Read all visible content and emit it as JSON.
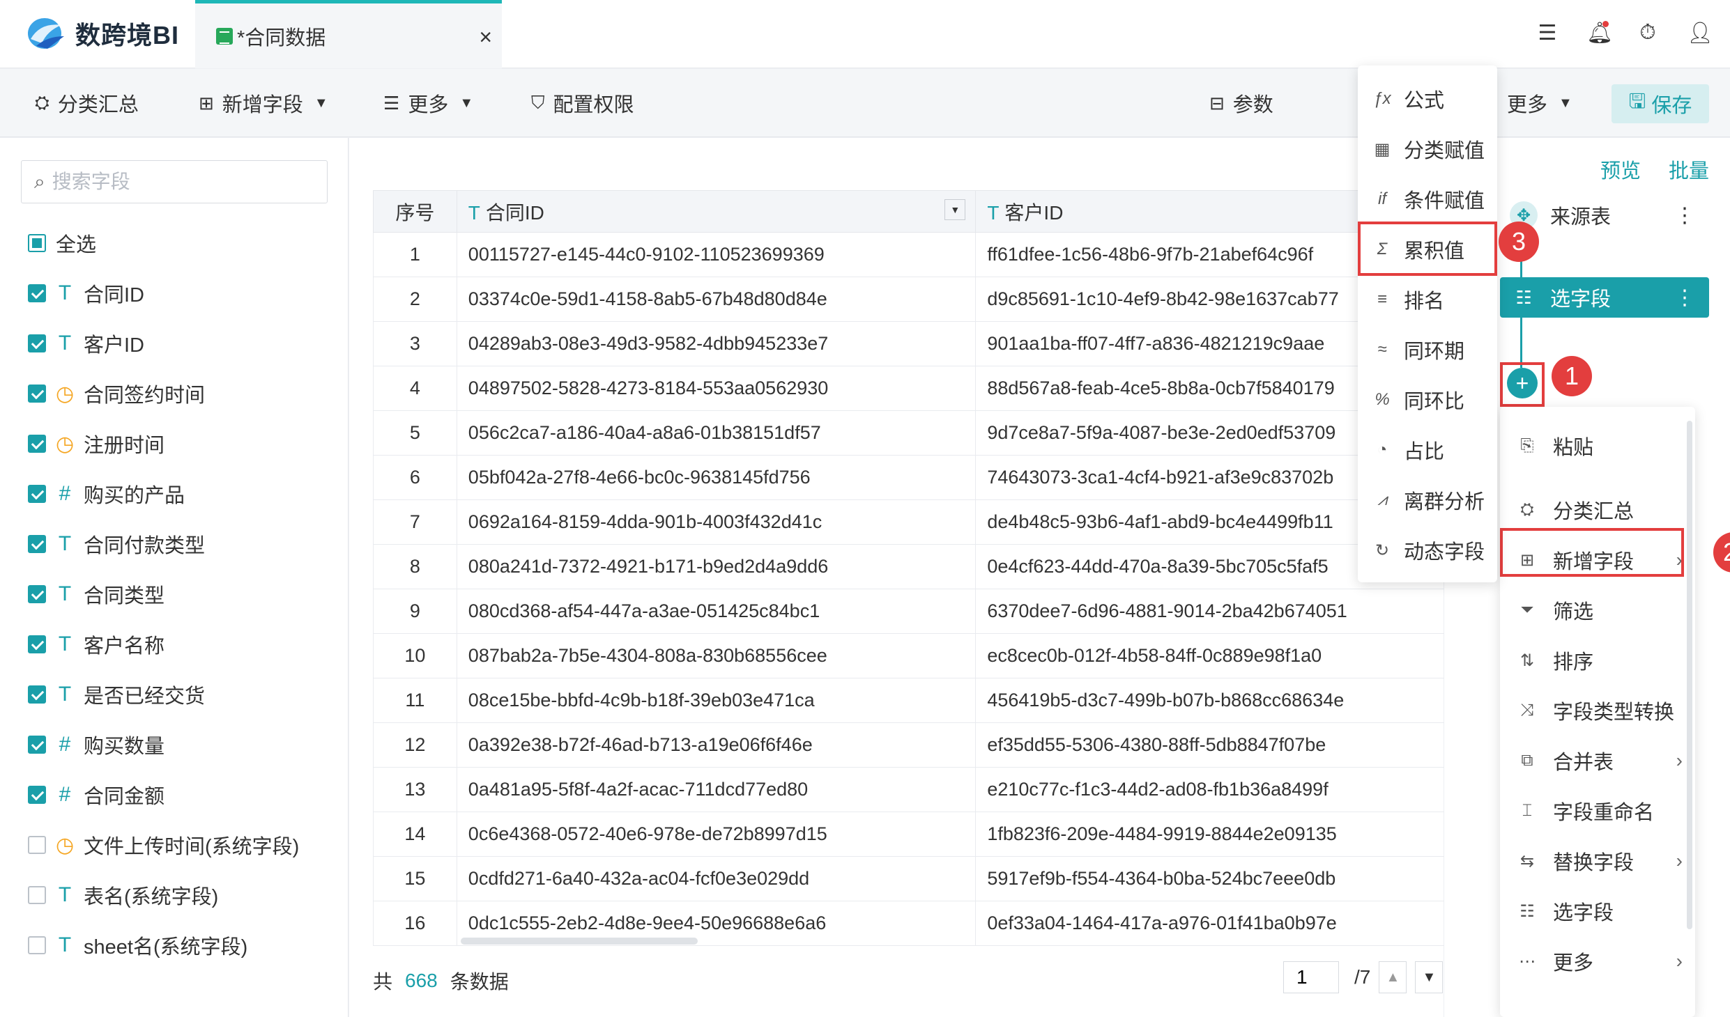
{
  "app": {
    "brand": "数跨境BI",
    "tab_title": "*合同数据",
    "tab_close": "×"
  },
  "top_icons": [
    "list-check-icon",
    "bell-icon",
    "timer-icon",
    "user-icon"
  ],
  "toolbar": {
    "group_summary": "分类汇总",
    "add_field": "新增字段",
    "more": "更多",
    "config_permission": "配置权限",
    "params": "参数",
    "more_right": "更多",
    "save": "保存"
  },
  "left_panel": {
    "search_placeholder": "搜索字段",
    "select_all": "全选",
    "fields": [
      {
        "name": "合同ID",
        "type": "T",
        "checked": true
      },
      {
        "name": "客户ID",
        "type": "T",
        "checked": true
      },
      {
        "name": "合同签约时间",
        "type": "time",
        "checked": true
      },
      {
        "name": "注册时间",
        "type": "time",
        "checked": true
      },
      {
        "name": "购买的产品",
        "type": "#",
        "checked": true
      },
      {
        "name": "合同付款类型",
        "type": "T",
        "checked": true
      },
      {
        "name": "合同类型",
        "type": "T",
        "checked": true
      },
      {
        "name": "客户名称",
        "type": "T",
        "checked": true
      },
      {
        "name": "是否已经交货",
        "type": "T",
        "checked": true
      },
      {
        "name": "购买数量",
        "type": "#",
        "checked": true
      },
      {
        "name": "合同金额",
        "type": "#",
        "checked": true
      },
      {
        "name": "文件上传时间(系统字段)",
        "type": "time",
        "checked": false
      },
      {
        "name": "表名(系统字段)",
        "type": "T",
        "checked": false
      },
      {
        "name": "sheet名(系统字段)",
        "type": "T",
        "checked": false
      }
    ]
  },
  "table": {
    "headers": {
      "index": "序号",
      "col1": "合同ID",
      "col2": "客户ID",
      "type_mark": "T"
    },
    "rows": [
      [
        "1",
        "00115727-e145-44c0-9102-110523699369",
        "ff61dfee-1c56-48b6-9f7b-21abef64c96f"
      ],
      [
        "2",
        "03374c0e-59d1-4158-8ab5-67b48d80d84e",
        "d9c85691-1c10-4ef9-8b42-98e1637cab77"
      ],
      [
        "3",
        "04289ab3-08e3-49d3-9582-4dbb945233e7",
        "901aa1ba-ff07-4ff7-a836-4821219c9aae"
      ],
      [
        "4",
        "04897502-5828-4273-8184-553aa0562930",
        "88d567a8-feab-4ce5-8b8a-0cb7f5840179"
      ],
      [
        "5",
        "056c2ca7-a186-40a4-a8a6-01b38151df57",
        "9d7ce8a7-5f9a-4087-be3e-2ed0edf53709"
      ],
      [
        "6",
        "05bf042a-27f8-4e66-bc0c-9638145fd756",
        "74643073-3ca1-4cf4-b921-af3e9c83702b"
      ],
      [
        "7",
        "0692a164-8159-4dda-901b-4003f432d41c",
        "de4b48c5-93b6-4af1-abd9-bc4e4499fb11"
      ],
      [
        "8",
        "080a241d-7372-4921-b171-b9ed2d4a9dd6",
        "0e4cf623-44dd-470a-8a39-5bc705c5faf5"
      ],
      [
        "9",
        "080cd368-af54-447a-a3ae-051425c84bc1",
        "6370dee7-6d96-4881-9014-2ba42b674051"
      ],
      [
        "10",
        "087bab2a-7b5e-4304-808a-830b68556cee",
        "ec8cec0b-012f-4b58-84ff-0c889e98f1a0"
      ],
      [
        "11",
        "08ce15be-bbfd-4c9b-b18f-39eb03e471ca",
        "456419b5-d3c7-499b-b07b-b868cc68634e"
      ],
      [
        "12",
        "0a392e38-b72f-46ad-b713-a19e06f6f46e",
        "ef35dd55-5306-4380-88ff-5db8847f07be"
      ],
      [
        "13",
        "0a481a95-5f8f-4a2f-acac-711dcd77ed80",
        "e210c77c-f1c3-44d2-ad08-fb1b36a8499f"
      ],
      [
        "14",
        "0c6e4368-0572-40e6-978e-de72b8997d15",
        "1fb823f6-209e-4484-9919-8844e2e09135"
      ],
      [
        "15",
        "0cdfd271-6a40-432a-ac04-fcf0e3e029dd",
        "5917ef9b-f554-4364-b0ba-524bc7eee0db"
      ],
      [
        "16",
        "0dc1c555-2eb2-4d8e-9ee4-50e96688e6a6",
        "0ef33a04-1464-417a-a976-01f41ba0b97e"
      ]
    ]
  },
  "footer": {
    "prefix": "共",
    "count": "668",
    "suffix": "条数据",
    "page": "1",
    "total_pages": "/7"
  },
  "flow": {
    "preview": "预览",
    "batch": "批量",
    "source_node": "来源表",
    "select_node": "选字段",
    "plus": "+"
  },
  "badges": [
    "1",
    "2",
    "3"
  ],
  "context_menu": [
    {
      "label": "粘贴",
      "icon": "paste-icon",
      "arrow": false
    },
    {
      "label": "分类汇总",
      "icon": "group-icon",
      "arrow": false
    },
    {
      "label": "新增字段",
      "icon": "add-field-icon",
      "arrow": true
    },
    {
      "label": "筛选",
      "icon": "filter-icon",
      "arrow": false
    },
    {
      "label": "排序",
      "icon": "sort-icon",
      "arrow": false
    },
    {
      "label": "字段类型转换",
      "icon": "convert-icon",
      "arrow": false
    },
    {
      "label": "合并表",
      "icon": "merge-icon",
      "arrow": true
    },
    {
      "label": "字段重命名",
      "icon": "rename-icon",
      "arrow": false
    },
    {
      "label": "替换字段",
      "icon": "replace-icon",
      "arrow": true
    },
    {
      "label": "选字段",
      "icon": "select-field-icon",
      "arrow": false
    },
    {
      "label": "更多",
      "icon": "more-icon",
      "arrow": true
    }
  ],
  "field_menu": [
    {
      "label": "公式",
      "icon": "formula-icon"
    },
    {
      "label": "分类赋值",
      "icon": "category-assign-icon"
    },
    {
      "label": "条件赋值",
      "icon": "condition-assign-icon"
    },
    {
      "label": "累积值",
      "icon": "cumulative-icon"
    },
    {
      "label": "排名",
      "icon": "rank-icon"
    },
    {
      "label": "同环期",
      "icon": "period-icon"
    },
    {
      "label": "同环比",
      "icon": "ratio-icon"
    },
    {
      "label": "占比",
      "icon": "proportion-icon"
    },
    {
      "label": "离群分析",
      "icon": "outlier-icon"
    },
    {
      "label": "动态字段",
      "icon": "dynamic-field-icon"
    }
  ],
  "colors": {
    "accent": "#1a9fa9",
    "highlight_red": "#e33e3e",
    "time_icon": "#f5a623"
  }
}
